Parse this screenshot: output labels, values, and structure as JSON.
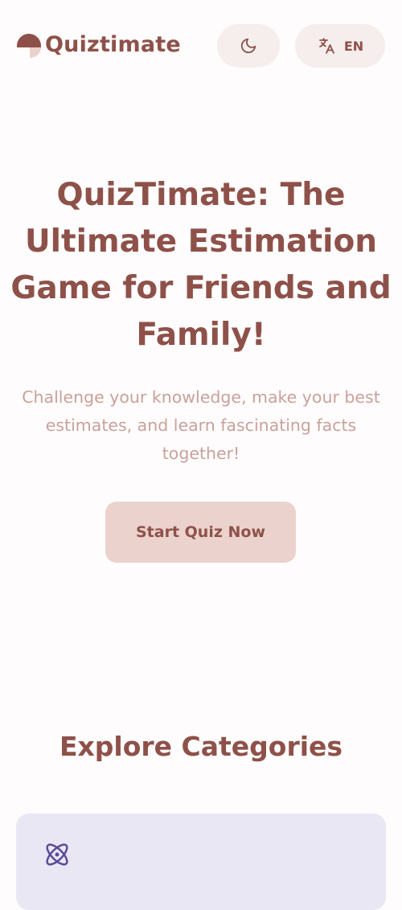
{
  "header": {
    "logo_text": "Quiztimate",
    "theme_toggle_icon": "moon-icon",
    "language_icon": "translate-icon",
    "language_code": "EN"
  },
  "hero": {
    "title": "QuizTimate: The Ultimate Estimation Game for Friends and Family!",
    "subtitle": "Challenge your knowledge, make your best estimates, and learn fascinating facts together!",
    "cta_label": "Start Quiz Now"
  },
  "categories": {
    "title": "Explore Categories",
    "items": [
      {
        "icon": "atom-icon"
      }
    ]
  },
  "colors": {
    "brand": "#8e5149",
    "subtitle": "#c9a19b",
    "button_bg": "#ebd2cd",
    "pill_bg": "#f5eeec",
    "card_bg": "#e9e7f3",
    "icon_accent": "#5b4a99"
  }
}
